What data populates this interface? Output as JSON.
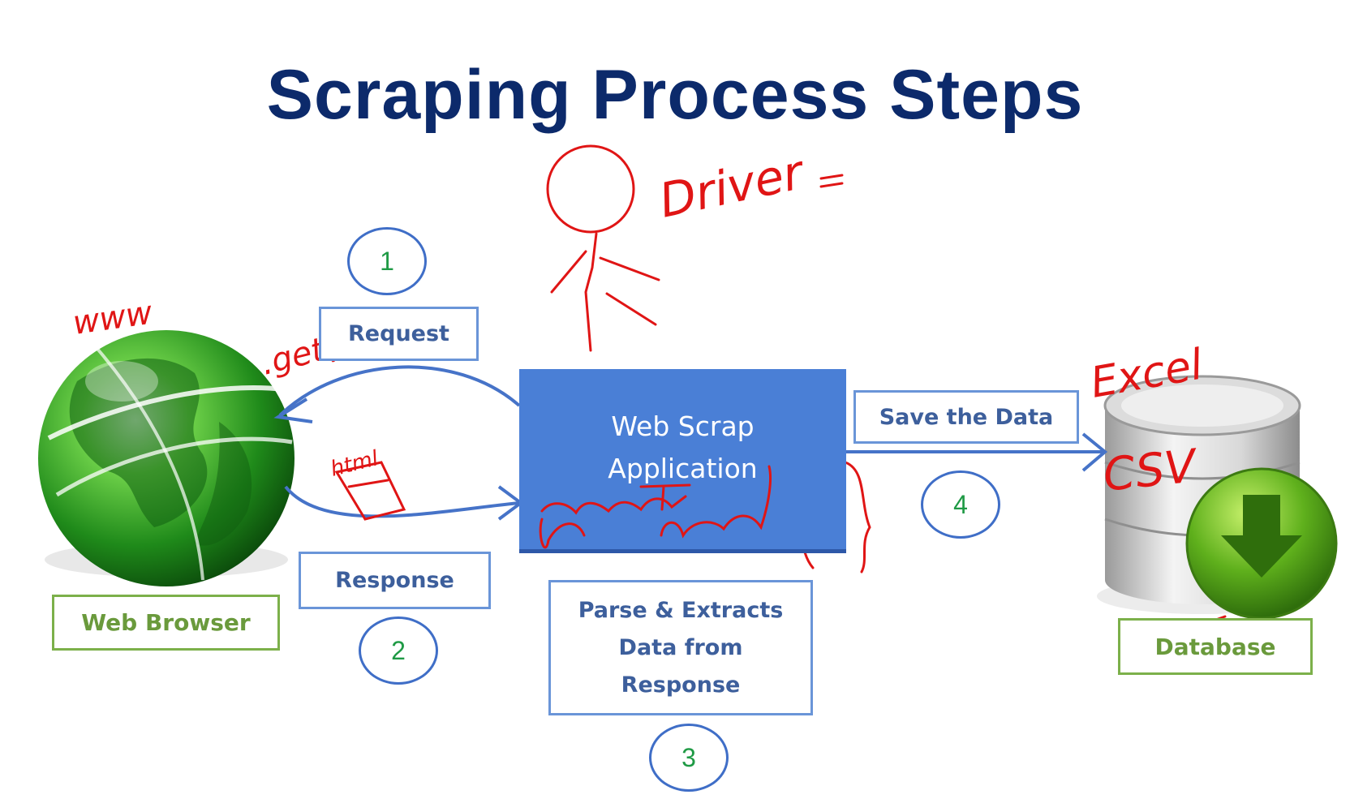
{
  "title": "Scraping Process Steps",
  "labels": {
    "request": "Request",
    "response": "Response",
    "web_browser": "Web Browser",
    "web_scrap_application": "Web Scrap\nApplication",
    "parse_extract": "Parse & Extracts\nData from\nResponse",
    "save_data": "Save the Data",
    "database": "Database"
  },
  "steps": [
    "1",
    "2",
    "3",
    "4"
  ],
  "annotations": {
    "www": "www",
    "driver": "Driver",
    "get_url": ".get(URL)",
    "html": "html",
    "excel": "Excel",
    "csv": "CSV"
  },
  "colors": {
    "title": "#0c2a6b",
    "app_box": "#4a7fd6",
    "blue_border": "#6a95d8",
    "green_border": "#7cb04a",
    "step_number": "#1f9a45",
    "ink": "#e01515"
  }
}
